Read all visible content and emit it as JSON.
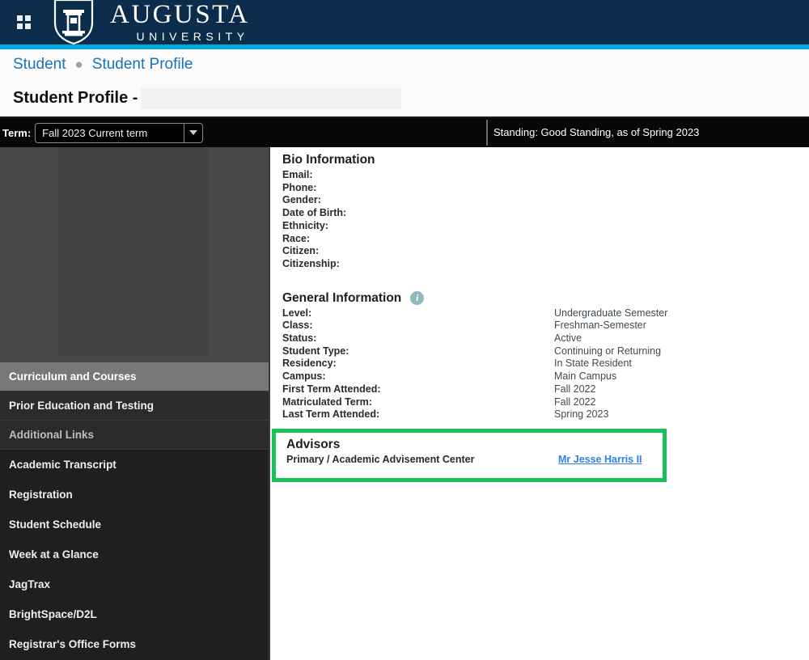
{
  "header": {
    "grid_icon": "grid-menu-icon",
    "shield_icon": "augusta-shield-icon",
    "brand_line1": "AUGUSTA",
    "brand_line2": "UNIVERSITY",
    "accent_color": "#00a9e0",
    "background_color": "#0c2c4c"
  },
  "breadcrumb": {
    "items": [
      {
        "label": "Student"
      },
      {
        "label": "Student Profile"
      }
    ],
    "separator": "●"
  },
  "page": {
    "title": "Student Profile -",
    "title_redacted": true
  },
  "term_bar": {
    "term_label": "Term:",
    "term_value": "Fall 2023 Current term",
    "term_options": [
      "Fall 2023 Current term"
    ],
    "dropdown_icon": "chevron-down-icon",
    "standing": "Standing: Good Standing, as of Spring 2023"
  },
  "sidebar": {
    "photo_placeholder": "student-photo-placeholder",
    "sections": [
      {
        "label": "Curriculum and Courses",
        "state": "active"
      },
      {
        "label": "Prior Education and Testing",
        "state": "default"
      },
      {
        "label": "Additional Links",
        "state": "muted"
      }
    ],
    "links": [
      {
        "label": "Academic Transcript"
      },
      {
        "label": "Registration"
      },
      {
        "label": "Student Schedule"
      },
      {
        "label": "Week at a Glance"
      },
      {
        "label": "JagTrax"
      },
      {
        "label": "BrightSpace/D2L"
      },
      {
        "label": "Registrar's Office Forms"
      }
    ]
  },
  "bio": {
    "heading": "Bio Information",
    "fields": [
      {
        "label": "Email:",
        "value": ""
      },
      {
        "label": "Phone:",
        "value": ""
      },
      {
        "label": "Gender:",
        "value": ""
      },
      {
        "label": "Date of Birth:",
        "value": ""
      },
      {
        "label": "Ethnicity:",
        "value": ""
      },
      {
        "label": "Race:",
        "value": ""
      },
      {
        "label": "Citizen:",
        "value": ""
      },
      {
        "label": "Citizenship:",
        "value": ""
      }
    ]
  },
  "general": {
    "heading": "General Information",
    "info_icon": "info-icon",
    "fields": [
      {
        "label": "Level:",
        "value": "Undergraduate Semester"
      },
      {
        "label": "Class:",
        "value": "Freshman-Semester"
      },
      {
        "label": "Status:",
        "value": "Active"
      },
      {
        "label": "Student Type:",
        "value": "Continuing or Returning"
      },
      {
        "label": "Residency:",
        "value": "In State Resident"
      },
      {
        "label": "Campus:",
        "value": "Main Campus"
      },
      {
        "label": "First Term Attended:",
        "value": "Fall 2022"
      },
      {
        "label": "Matriculated Term:",
        "value": "Fall 2022"
      },
      {
        "label": "Last Term Attended:",
        "value": "Spring 2023"
      }
    ]
  },
  "advisors": {
    "heading": "Advisors",
    "role": "Primary / Academic Advisement Center",
    "name": "Mr Jesse Harris II",
    "highlight_color": "#17c257"
  }
}
